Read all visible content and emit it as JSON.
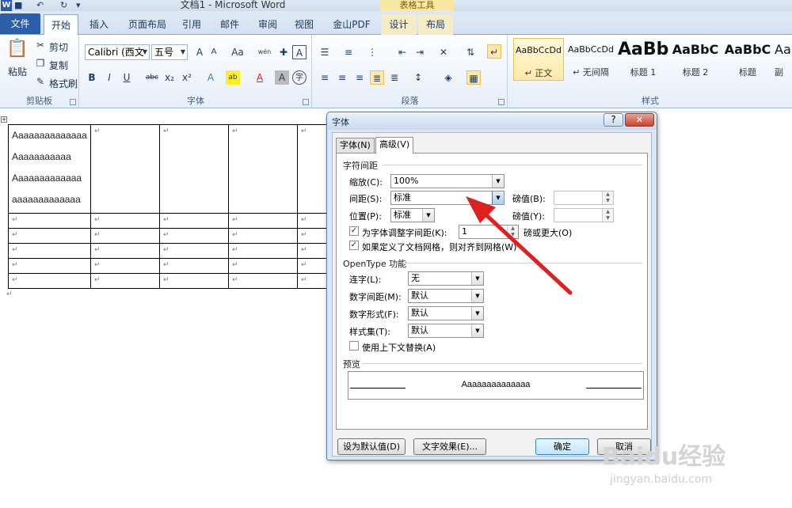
{
  "window": {
    "title": "文档1 - Microsoft Word",
    "context_tool": "表格工具"
  },
  "tabs": [
    "文件",
    "开始",
    "插入",
    "页面布局",
    "引用",
    "邮件",
    "审阅",
    "视图",
    "金山PDF",
    "设计",
    "布局"
  ],
  "ribbon": {
    "clipboard": {
      "paste": "粘贴",
      "cut": "剪切",
      "copy": "复制",
      "format_painter": "格式刷",
      "label": "剪贴板"
    },
    "font": {
      "font_name": "Calibri (西文",
      "font_size": "五号",
      "label": "字体",
      "buttons": [
        "A",
        "A",
        "Aa",
        "wén",
        "A",
        "B",
        "I",
        "U",
        "abc",
        "x₂",
        "x²",
        "A",
        "ab",
        "A",
        "A",
        "字"
      ]
    },
    "paragraph": {
      "label": "段落"
    },
    "styles": {
      "label": "样式",
      "items": [
        {
          "sample": "AaBbCcDd",
          "name": "↵ 正文"
        },
        {
          "sample": "AaBbCcDd",
          "name": "↵ 无间隔"
        },
        {
          "sample": "AaBb",
          "name": "标题 1"
        },
        {
          "sample": "AaBbC",
          "name": "标题 2"
        },
        {
          "sample": "AaBbC",
          "name": "标题"
        },
        {
          "sample": "Aa",
          "name": "副"
        }
      ]
    }
  },
  "document": {
    "cell_lines": [
      "Aaaaaaaaaaaaaa",
      "Aaaaaaaaaaa",
      "Aaaaaaaaaaaaa",
      "aaaaaaaaaaaaa"
    ],
    "cell_mark": "↵"
  },
  "dialog": {
    "title": "字体",
    "help": "?",
    "close": "✕",
    "tabs": [
      "字体(N)",
      "高级(V)"
    ],
    "char_spacing_title": "字符间距",
    "scale_label": "缩放(C):",
    "scale_value": "100%",
    "spacing_label": "间距(S):",
    "spacing_value": "标准",
    "spacing_by_label": "磅值(B):",
    "position_label": "位置(P):",
    "position_value": "标准",
    "position_by_label": "磅值(Y):",
    "kerning_label": "为字体调整字间距(K):",
    "kerning_value": "1",
    "kerning_suffix": "磅或更大(O)",
    "grid_label": "如果定义了文档网格，则对齐到网格(W)",
    "opentype_title": "OpenType 功能",
    "ligatures_label": "连字(L):",
    "ligatures_value": "无",
    "num_spacing_label": "数字间距(M):",
    "num_spacing_value": "默认",
    "num_forms_label": "数字形式(F):",
    "num_forms_value": "默认",
    "stylistic_label": "样式集(T):",
    "stylistic_value": "默认",
    "contextual_label": "使用上下文替换(A)",
    "preview_title": "预览",
    "preview_text": "Aaaaaaaaaaaaaa",
    "btn_default": "设为默认值(D)",
    "btn_effects": "文字效果(E)...",
    "btn_ok": "确定",
    "btn_cancel": "取消"
  },
  "watermark": {
    "logo": "Baidu经验",
    "url": "jingyan.baidu.com"
  },
  "colors": {
    "file_tab": "#2b5faa",
    "arrow": "#e02020",
    "close": "#c4432c"
  }
}
